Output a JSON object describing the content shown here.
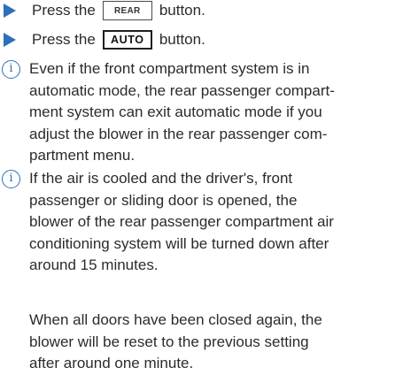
{
  "steps": [
    {
      "before": "Press the",
      "key": "REAR",
      "after": "button."
    },
    {
      "before": "Press the",
      "key": "AUTO",
      "after": "button."
    }
  ],
  "notes": [
    {
      "icon": "info-icon",
      "text": "Even if the front compartment system is in\nautomatic mode, the rear passenger compart-\nment system can exit automatic mode if you\nadjust the blower in the rear passenger com-\npartment menu."
    },
    {
      "icon": "info-icon",
      "text": "If the air is cooled and the driver's, front\npassenger or sliding door is opened, the\nblower of the rear passenger compartment air\nconditioning system will be turned down after\naround 15 minutes.",
      "text_continued": "When all doors have been closed again, the\nblower will be reset to the previous setting\nafter around one minute."
    }
  ],
  "colors": {
    "accent": "#2f6fb8",
    "text": "#2b2b2b"
  }
}
